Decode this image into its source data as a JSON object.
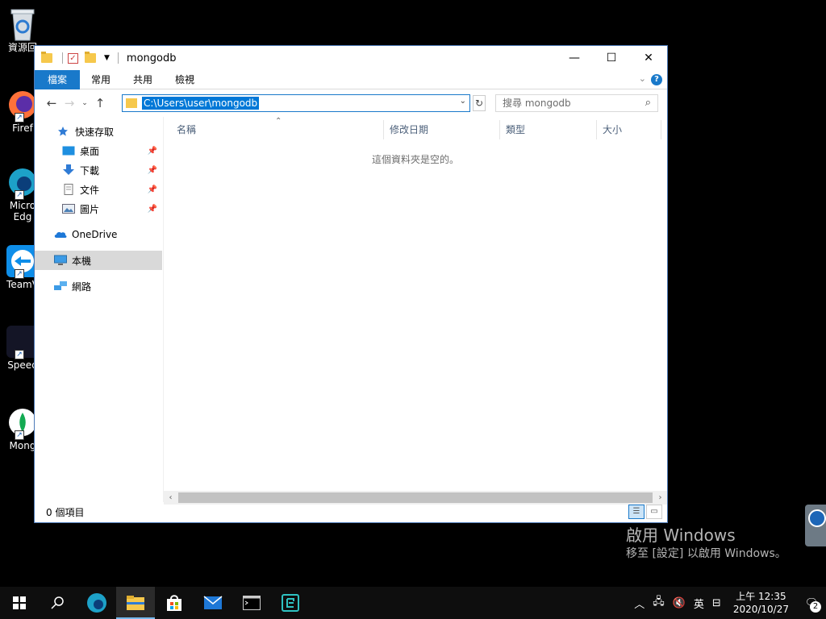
{
  "desktop": {
    "icons": [
      {
        "label": "資源回"
      },
      {
        "label": "Firef"
      },
      {
        "label": "Micro"
      },
      {
        "label": "Edg"
      },
      {
        "label": "TeamV"
      },
      {
        "label": "Speed"
      },
      {
        "label": "Mong"
      }
    ]
  },
  "window": {
    "title": "mongodb",
    "buttons": {
      "minimize": "—",
      "maximize": "☐",
      "close": "✕"
    },
    "ribbon_tabs": [
      "檔案",
      "常用",
      "共用",
      "檢視"
    ],
    "ribbon_help": "?",
    "address": {
      "path": "C:\\Users\\user\\mongodb"
    },
    "search": {
      "placeholder": "搜尋 mongodb"
    },
    "nav_pane": {
      "quick_access": "快速存取",
      "desktop": "桌面",
      "downloads": "下載",
      "documents": "文件",
      "pictures": "圖片",
      "onedrive": "OneDrive",
      "this_pc": "本機",
      "network": "網路"
    },
    "columns": {
      "name": "名稱",
      "modified": "修改日期",
      "type": "類型",
      "size": "大小"
    },
    "empty_message": "這個資料夾是空的。",
    "status": "0 個項目"
  },
  "watermark": {
    "line1": "啟用 Windows",
    "line2": "移至 [設定] 以啟用 Windows。"
  },
  "taskbar": {
    "tray": {
      "ime": "英",
      "time": "上午 12:35",
      "date": "2020/10/27",
      "notification_count": "2"
    }
  },
  "colors": {
    "accent": "#1979ca",
    "selection": "#0078d7",
    "taskbar": "#0e0e0e"
  }
}
